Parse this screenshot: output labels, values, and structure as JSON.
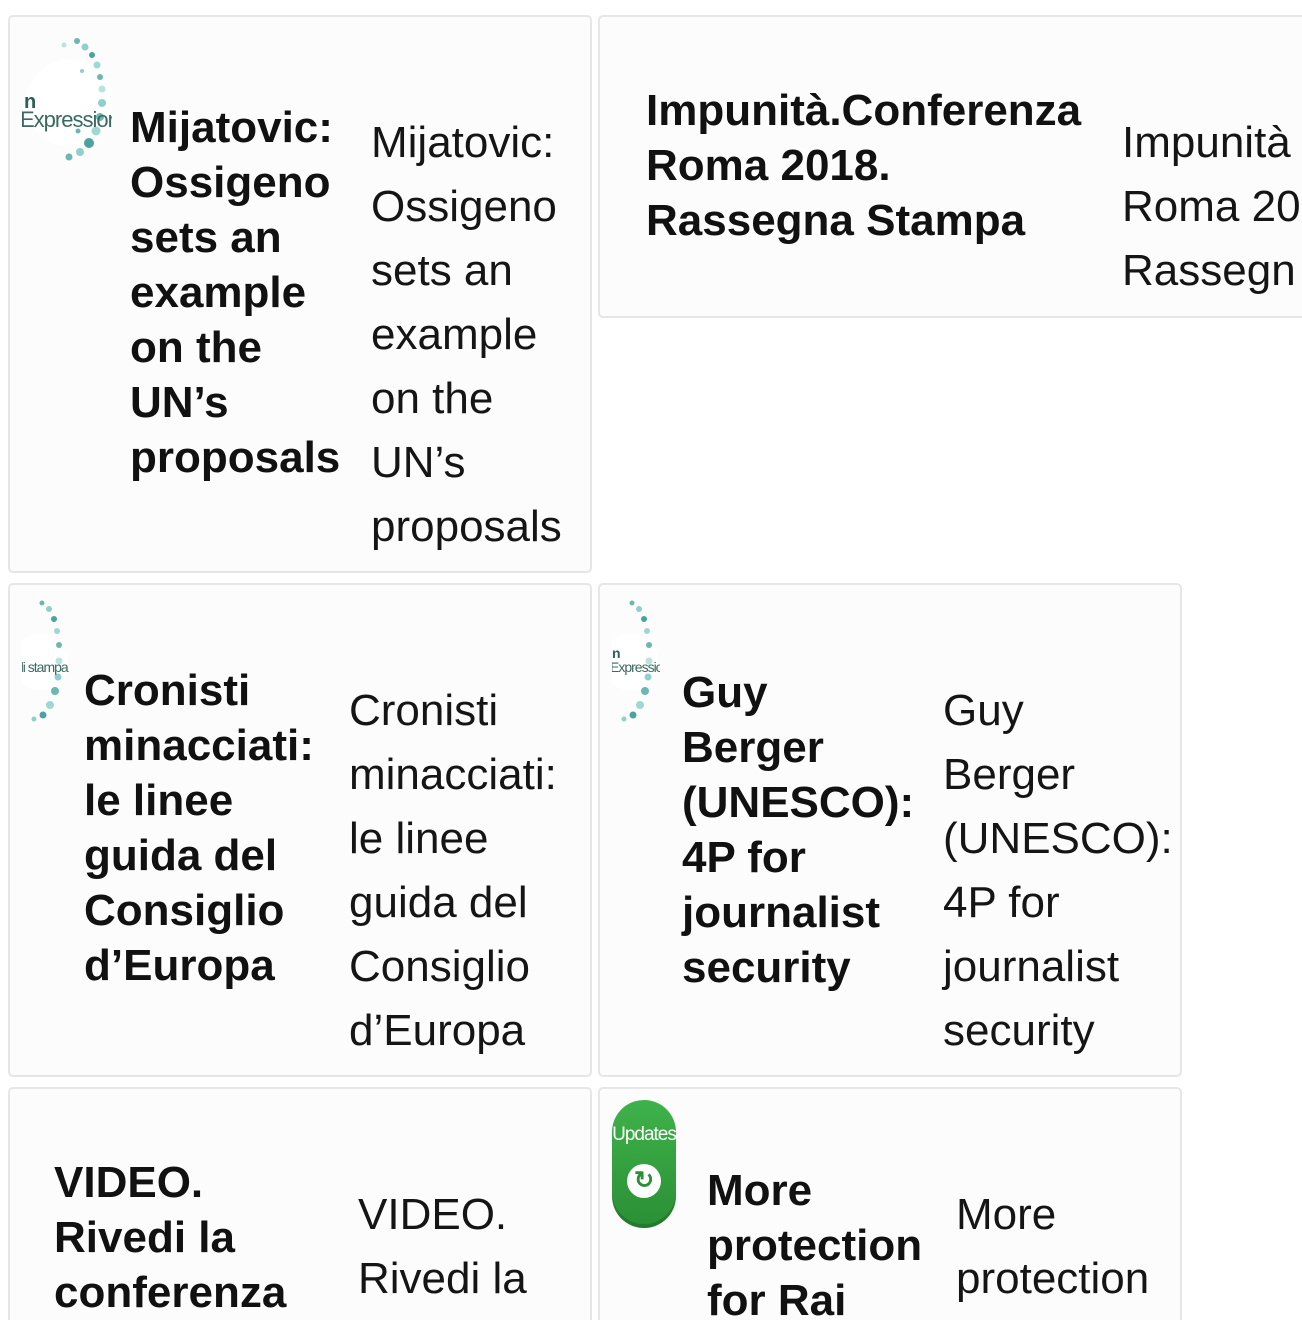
{
  "cards": [
    {
      "title_lines": [
        "Mijatovic:",
        "Ossigeno",
        "sets an",
        "example",
        "on the",
        "UN’s",
        "proposals"
      ],
      "excerpt_lines": [
        "Mijatovic:",
        "Ossigeno",
        "sets an",
        "example",
        "on the",
        "UN’s",
        "proposals"
      ],
      "thumb_text_1": "n",
      "thumb_text_2": "Expression"
    },
    {
      "title_lines": [
        "Impunità.Conferenza",
        "Roma 2018.",
        "Rassegna Stampa"
      ],
      "excerpt_lines": [
        "Impunità",
        "Roma 20",
        "Rassegn"
      ]
    },
    {
      "title_lines": [
        "Cronisti",
        "minacciati:",
        "le linee",
        "guida del",
        "Consiglio",
        "d’Europa"
      ],
      "excerpt_lines": [
        "Cronisti",
        "minacciati:",
        "le linee",
        "guida del",
        "Consiglio",
        "d’Europa"
      ],
      "thumb_text_1": "di stampa"
    },
    {
      "title_lines": [
        "Guy",
        "Berger",
        "(UNESCO):",
        "4P for",
        "journalist",
        "security"
      ],
      "excerpt_lines": [
        "Guy",
        "Berger",
        "(UNESCO):",
        "4P for",
        "journalist",
        "security"
      ],
      "thumb_text_1": "n",
      "thumb_text_2": "Expression"
    },
    {
      "title_lines": [
        "VIDEO.",
        "Rivedi la",
        "conferenza"
      ],
      "excerpt_lines": [
        "VIDEO.",
        "Rivedi la"
      ]
    },
    {
      "title_lines": [
        "More",
        "protection",
        "for Rai"
      ],
      "excerpt_lines": [
        "More",
        "protection"
      ],
      "badge_label": "Updates"
    }
  ],
  "colors": {
    "card_border": "#e6e6e6",
    "card_background": "#fcfcfc",
    "badge_green": "#3fb24a"
  },
  "icons": {
    "card1_thumb": "dotted-circle-logo-icon",
    "card3_thumb": "dotted-circle-logo-icon",
    "card4_thumb": "dotted-circle-logo-icon",
    "card6_thumb": "updates-badge-icon"
  }
}
